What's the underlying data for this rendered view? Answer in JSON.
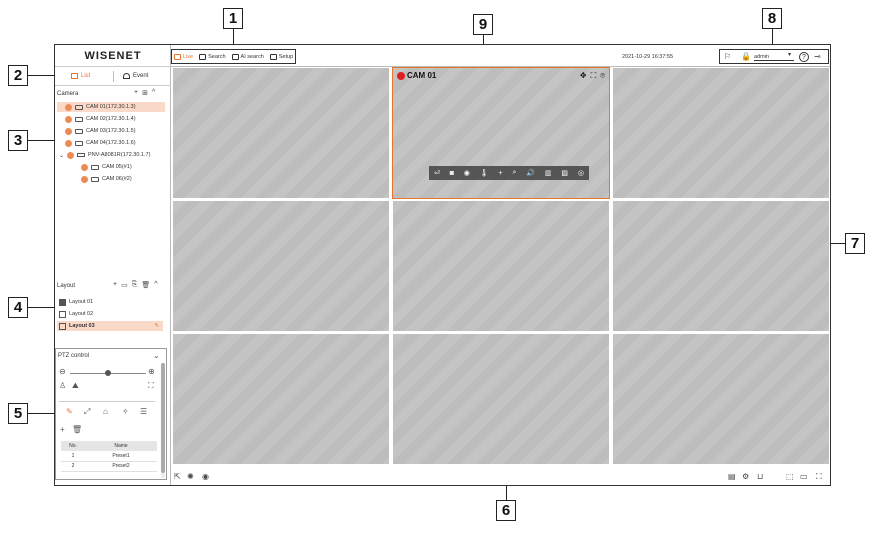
{
  "callouts": [
    "1",
    "2",
    "3",
    "4",
    "5",
    "6",
    "7",
    "8",
    "9"
  ],
  "app": {
    "logo": "WISENET",
    "modes": {
      "list": "List",
      "event": "Event"
    },
    "camera_section": {
      "title": "Camera",
      "tools": [
        "+",
        "⊞",
        "^"
      ]
    },
    "cameras": [
      {
        "label": "CAM 01(172.30.1.3)",
        "level": 0,
        "type": "cam",
        "selected": true
      },
      {
        "label": "CAM 02(172.30.1.4)",
        "level": 0,
        "type": "cam",
        "selected": false
      },
      {
        "label": "CAM 03(172.30.1.5)",
        "level": 0,
        "type": "cam",
        "selected": false
      },
      {
        "label": "CAM 04(172.30.1.6)",
        "level": 0,
        "type": "cam",
        "selected": false
      },
      {
        "label": "PNV-A8081R(172.30.1.7)",
        "level": 0,
        "type": "nvr",
        "selected": false
      },
      {
        "label": "CAM 05(#1)",
        "level": 1,
        "type": "cam",
        "selected": false
      },
      {
        "label": "CAM 06(#2)",
        "level": 1,
        "type": "cam",
        "selected": false
      }
    ],
    "layout_section": {
      "title": "Layout",
      "tools": [
        "+",
        "▭",
        "⎘",
        "🗑",
        "^"
      ]
    },
    "layouts": [
      {
        "label": "Layout 01",
        "icon": "filled-square-icon",
        "selected": false
      },
      {
        "label": "Layout 02",
        "icon": "grid-icon",
        "selected": false
      },
      {
        "label": "Layout 03",
        "icon": "grid-icon",
        "selected": true
      }
    ],
    "ptz": {
      "title": "PTZ control",
      "headers": [
        "No.",
        "Name"
      ],
      "presets": [
        {
          "no": "1",
          "name": "Preset1"
        },
        {
          "no": "2",
          "name": "Preset2"
        }
      ],
      "zoom_level": 0.5
    },
    "menu": [
      {
        "label": "Live",
        "active": true,
        "icon": "live-icon"
      },
      {
        "label": "Search",
        "active": false,
        "icon": "search-icon"
      },
      {
        "label": "AI search",
        "active": false,
        "icon": "ai-search-icon"
      },
      {
        "label": "Setup",
        "active": false,
        "icon": "gear-icon"
      }
    ],
    "datetime": "2021-10-29 16:37:55",
    "user": "admin",
    "active_camera_label": "CAM 01",
    "colors": {
      "accent": "#e8742a",
      "selected_bg": "#fbd9c8",
      "rec": "#e02020",
      "camera_dot": "#f08a55"
    }
  }
}
